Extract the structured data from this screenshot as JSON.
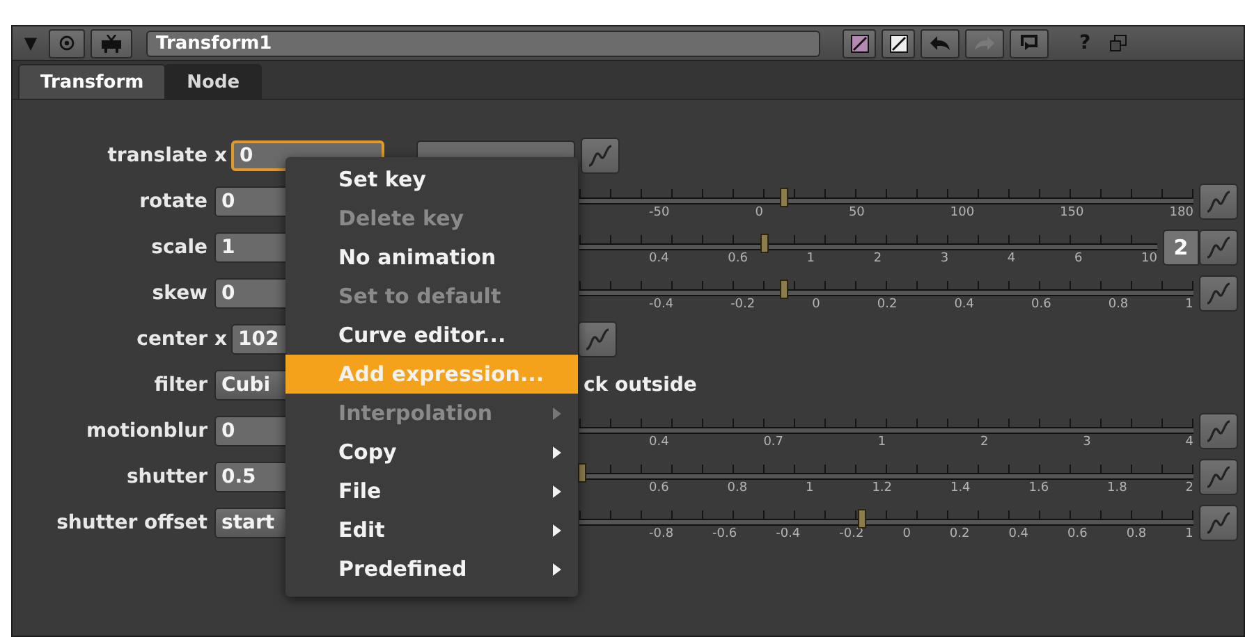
{
  "panel": {
    "collapse_glyph": "▼",
    "name": "Transform1",
    "help": "?"
  },
  "tabs": [
    {
      "label": "Transform",
      "selected": true
    },
    {
      "label": "Node",
      "selected": false
    }
  ],
  "knobs": [
    {
      "kind": "xy",
      "label": "translate",
      "x_label": "x",
      "x_value": "0",
      "focused": true,
      "y_field": true
    },
    {
      "kind": "slider",
      "label": "rotate",
      "value": "0",
      "level": 0.334,
      "ticks": [
        "-50",
        "0",
        "50",
        "100",
        "150",
        "180"
      ]
    },
    {
      "kind": "slider",
      "label": "scale",
      "value": "1",
      "level": 0.32,
      "ticks": [
        "0.4",
        "0.6",
        "1",
        "2",
        "3",
        "4",
        "6",
        "10"
      ],
      "count": "2"
    },
    {
      "kind": "slider",
      "label": "skew",
      "value": "0",
      "level": 0.334,
      "ticks": [
        "-0.4",
        "-0.2",
        "0",
        "0.2",
        "0.4",
        "0.6",
        "0.8",
        "1"
      ]
    },
    {
      "kind": "xy",
      "label": "center",
      "x_label": "x",
      "x_value": "102",
      "focused": false
    },
    {
      "kind": "dropdown",
      "label": "filter",
      "value": "Cubi",
      "extra": "ck outside"
    },
    {
      "kind": "slider",
      "label": "motionblur",
      "value": "0",
      "ticks": [
        "0.4",
        "0.7",
        "1",
        "2",
        "3",
        "4"
      ]
    },
    {
      "kind": "slider",
      "label": "shutter",
      "value": "0.5",
      "level": 0.005,
      "ticks": [
        "0.6",
        "0.8",
        "1",
        "1.2",
        "1.4",
        "1.6",
        "1.8",
        "2"
      ]
    },
    {
      "kind": "dropdown-slider",
      "label": "shutter offset",
      "value": "start",
      "level": 0.46,
      "ticks": [
        "-0.8",
        "-0.6",
        "-0.4",
        "-0.2",
        "0",
        "0.2",
        "0.4",
        "0.6",
        "0.8",
        "1"
      ]
    }
  ],
  "context_menu": [
    {
      "label": "Set key",
      "disabled": false,
      "selected": false,
      "submenu": false
    },
    {
      "label": "Delete key",
      "disabled": true,
      "selected": false,
      "submenu": false
    },
    {
      "label": "No animation",
      "disabled": false,
      "selected": false,
      "submenu": false
    },
    {
      "label": "Set to default",
      "disabled": true,
      "selected": false,
      "submenu": false
    },
    {
      "label": "Curve editor...",
      "disabled": false,
      "selected": false,
      "submenu": false
    },
    {
      "label": "Add expression...",
      "disabled": false,
      "selected": true,
      "submenu": false
    },
    {
      "label": "Interpolation",
      "disabled": true,
      "selected": false,
      "submenu": true
    },
    {
      "label": "Copy",
      "disabled": false,
      "selected": false,
      "submenu": true
    },
    {
      "label": "File",
      "disabled": false,
      "selected": false,
      "submenu": true
    },
    {
      "label": "Edit",
      "disabled": false,
      "selected": false,
      "submenu": true
    },
    {
      "label": "Predefined",
      "disabled": false,
      "selected": false,
      "submenu": true
    }
  ]
}
